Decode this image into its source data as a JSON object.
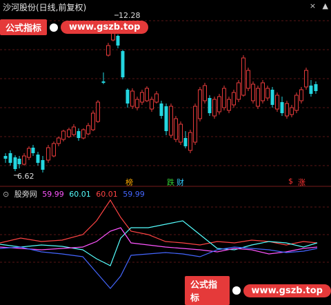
{
  "header": {
    "title": "沙河股份(日线,前复权)",
    "controls": [
      "×",
      "▲"
    ]
  },
  "watermark_top": {
    "label": "公式指标",
    "url": "www.gszb.top"
  },
  "watermark_bottom": {
    "label": "公式指标",
    "url": "www.gszb.top"
  },
  "price_labels": {
    "high": "12.28",
    "low": "6.62"
  },
  "signals": [
    {
      "text": "榜",
      "color": "#ffaa00"
    },
    {
      "text": "跌",
      "color": "#33cc33"
    },
    {
      "text": "财",
      "color": "#33ccff"
    },
    {
      "text": "$",
      "color": "#ff3333"
    },
    {
      "text": "涨",
      "color": "#ff3333"
    }
  ],
  "indicator": {
    "name": "股旁网",
    "values": [
      {
        "text": "59.99",
        "color": "#ff55ff"
      },
      {
        "text": "60.01",
        "color": "#55ffff"
      },
      {
        "text": "60.01",
        "color": "#ff4444"
      },
      {
        "text": "59.99",
        "color": "#4466ff"
      }
    ]
  },
  "colors": {
    "up": "#e83b3b",
    "down": "#24d6e0",
    "grid": "#5a1616"
  }
}
